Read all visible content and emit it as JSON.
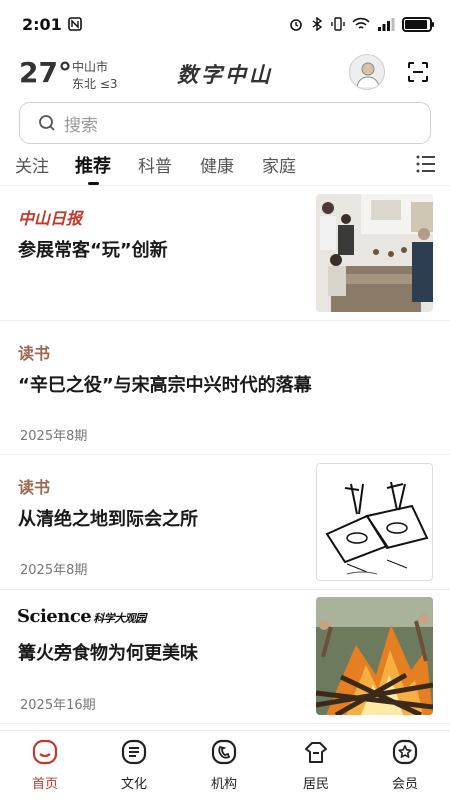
{
  "status": {
    "time": "2:01",
    "battery_level": 0.9
  },
  "header": {
    "temperature": "27°",
    "city": "中山市",
    "wind": "东北 ≤3",
    "app_title": "数字中山"
  },
  "search": {
    "placeholder": "搜索"
  },
  "tabs": [
    {
      "label": "关注"
    },
    {
      "label": "推荐"
    },
    {
      "label": "科普"
    },
    {
      "label": "健康"
    },
    {
      "label": "家庭"
    }
  ],
  "feed": [
    {
      "source": "中山日报",
      "title": "参展常客“玩”创新",
      "issue": ""
    },
    {
      "source": "读书",
      "title": "“辛巳之役”与宋高宗中兴时代的落幕",
      "issue": "2025年8期"
    },
    {
      "source": "读书",
      "title": "从清绝之地到际会之所",
      "issue": "2025年8期"
    },
    {
      "source": "Science",
      "source_sub": "科学大观园",
      "title": "篝火旁食物为何更美味",
      "issue": "2025年16期"
    }
  ],
  "bottom_nav": [
    {
      "label": "首页",
      "icon": "home-icon"
    },
    {
      "label": "文化",
      "icon": "culture-icon"
    },
    {
      "label": "机构",
      "icon": "institution-icon"
    },
    {
      "label": "居民",
      "icon": "resident-icon"
    },
    {
      "label": "会员",
      "icon": "member-icon"
    }
  ],
  "colors": {
    "accent": "#c0392b",
    "source_brown": "#9a6a52"
  }
}
